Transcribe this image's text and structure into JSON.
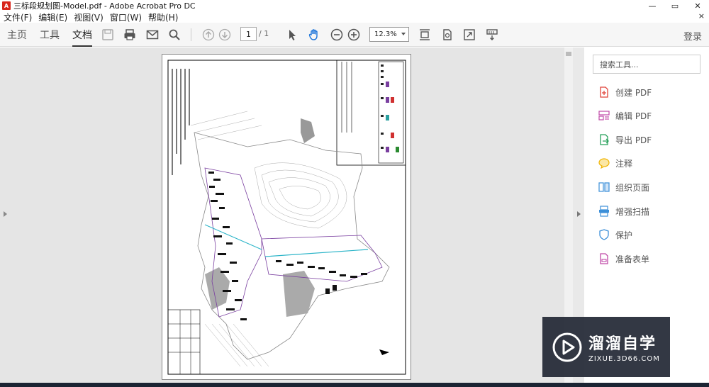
{
  "window": {
    "title": "三标段规划图-Model.pdf - Adobe Acrobat Pro DC",
    "controls": {
      "minimize": "—",
      "maximize": "▭",
      "close": "✕"
    }
  },
  "menu": {
    "items": [
      "文件(F)",
      "编辑(E)",
      "视图(V)",
      "窗口(W)",
      "帮助(H)"
    ],
    "close": "×"
  },
  "toolbar": {
    "tabs": [
      "主页",
      "工具",
      "文档"
    ],
    "active_tab": "文档",
    "page_current": "1",
    "page_total": "/ 1",
    "zoom": "12.3%",
    "login": "登录"
  },
  "tools_pane": {
    "search_placeholder": "搜索工具...",
    "items": [
      {
        "label": "创建 PDF",
        "icon": "create-pdf-icon",
        "color": "#e0443a"
      },
      {
        "label": "编辑 PDF",
        "icon": "edit-pdf-icon",
        "color": "#c04aa8"
      },
      {
        "label": "导出 PDF",
        "icon": "export-pdf-icon",
        "color": "#27a05a"
      },
      {
        "label": "注释",
        "icon": "comment-icon",
        "color": "#f0b400"
      },
      {
        "label": "组织页面",
        "icon": "organize-pages-icon",
        "color": "#3c8fd8"
      },
      {
        "label": "增强扫描",
        "icon": "enhance-scan-icon",
        "color": "#3c8fd8"
      },
      {
        "label": "保护",
        "icon": "protect-icon",
        "color": "#3c8fd8"
      },
      {
        "label": "准备表单",
        "icon": "prepare-form-icon",
        "color": "#c04aa8"
      }
    ]
  },
  "watermark": {
    "title": "溜溜自学",
    "subtitle": "ZIXUE.3D66.COM"
  }
}
